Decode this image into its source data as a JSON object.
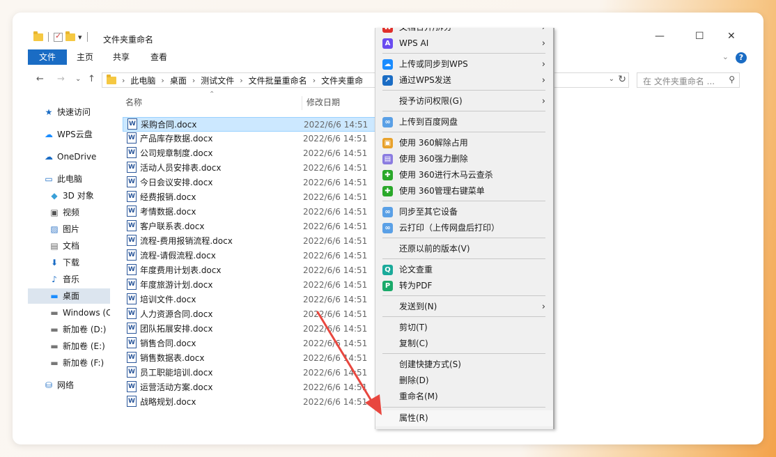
{
  "window": {
    "title": "文件夹重命名",
    "qat_dropdown": "▾",
    "min_glyph": "—",
    "max_glyph": "☐",
    "close_glyph": "✕"
  },
  "ribbon": {
    "tabs": [
      "文件",
      "主页",
      "共享",
      "查看"
    ],
    "help": "?"
  },
  "address": {
    "crumbs": [
      "此电脑",
      "桌面",
      "测试文件",
      "文件批量重命名",
      "文件夹重命"
    ],
    "search_placeholder": "在 文件夹重命名 ..."
  },
  "sidebar": {
    "items": [
      {
        "label": "快速访问",
        "icon": "star-icon"
      },
      {
        "label": "WPS云盘",
        "icon": "cloud-icon"
      },
      {
        "label": "OneDrive",
        "icon": "onedrive-icon"
      },
      {
        "label": "此电脑",
        "icon": "pc-icon"
      },
      {
        "label": "3D 对象",
        "icon": "cube-icon"
      },
      {
        "label": "视频",
        "icon": "video-icon"
      },
      {
        "label": "图片",
        "icon": "picture-icon"
      },
      {
        "label": "文档",
        "icon": "document-icon"
      },
      {
        "label": "下载",
        "icon": "download-icon"
      },
      {
        "label": "音乐",
        "icon": "music-icon"
      },
      {
        "label": "桌面",
        "icon": "desktop-icon"
      },
      {
        "label": "Windows (C",
        "icon": "drive-icon"
      },
      {
        "label": "新加卷 (D:)",
        "icon": "drive-icon"
      },
      {
        "label": "新加卷 (E:)",
        "icon": "drive-icon"
      },
      {
        "label": "新加卷 (F:)",
        "icon": "drive-icon"
      },
      {
        "label": "网络",
        "icon": "network-icon"
      }
    ],
    "selected": "桌面"
  },
  "filelist": {
    "columns": {
      "name": "名称",
      "date": "修改日期"
    },
    "files": [
      {
        "name": "采购合同.docx",
        "date": "2022/6/6 14:51"
      },
      {
        "name": "产品库存数据.docx",
        "date": "2022/6/6 14:51"
      },
      {
        "name": "公司规章制度.docx",
        "date": "2022/6/6 14:51"
      },
      {
        "name": "活动人员安排表.docx",
        "date": "2022/6/6 14:51"
      },
      {
        "name": "今日会议安排.docx",
        "date": "2022/6/6 14:51"
      },
      {
        "name": "经费报销.docx",
        "date": "2022/6/6 14:51"
      },
      {
        "name": "考情数据.docx",
        "date": "2022/6/6 14:51"
      },
      {
        "name": "客户联系表.docx",
        "date": "2022/6/6 14:51"
      },
      {
        "name": "流程-费用报销流程.docx",
        "date": "2022/6/6 14:51"
      },
      {
        "name": "流程-请假流程.docx",
        "date": "2022/6/6 14:51"
      },
      {
        "name": "年度费用计划表.docx",
        "date": "2022/6/6 14:51"
      },
      {
        "name": "年度旅游计划.docx",
        "date": "2022/6/6 14:51"
      },
      {
        "name": "培训文件.docx",
        "date": "2022/6/6 14:51"
      },
      {
        "name": "人力资源合同.docx",
        "date": "2022/6/6 14:51"
      },
      {
        "name": "团队拓展安排.docx",
        "date": "2022/6/6 14:51"
      },
      {
        "name": "销售合同.docx",
        "date": "2022/6/6 14:51"
      },
      {
        "name": "销售数据表.docx",
        "date": "2022/6/6 14:51"
      },
      {
        "name": "员工职能培训.docx",
        "date": "2022/6/6 14:51"
      },
      {
        "name": "运营活动方案.docx",
        "date": "2022/6/6 14:51"
      },
      {
        "name": "战略规划.docx",
        "date": "2022/6/6 14:51"
      }
    ]
  },
  "context_menu": {
    "items": [
      {
        "label": "文档合并/拆分",
        "icon": "wps-icon",
        "color": "#e0302b",
        "glyph": "W",
        "submenu": true
      },
      {
        "label": "WPS AI",
        "icon": "wps-ai-icon",
        "color": "#6a4cf0",
        "glyph": "A",
        "submenu": true
      },
      {
        "label": "上传或同步到WPS",
        "icon": "wps-cloud-icon",
        "color": "#1a8cff",
        "glyph": "☁",
        "submenu": true
      },
      {
        "label": "通过WPS发送",
        "icon": "share-icon",
        "color": "#1a6cc4",
        "glyph": "↗",
        "submenu": true
      },
      {
        "label": "授予访问权限(G)",
        "icon": "",
        "color": "",
        "glyph": "",
        "submenu": true
      },
      {
        "label": "上传到百度网盘",
        "icon": "baidu-icon",
        "color": "#5aa0e6",
        "glyph": "∞",
        "submenu": false
      },
      {
        "label": "使用 360解除占用",
        "icon": "360-unlock-icon",
        "color": "#e8a12a",
        "glyph": "▣",
        "submenu": false
      },
      {
        "label": "使用 360强力删除",
        "icon": "360-delete-icon",
        "color": "#8a7be0",
        "glyph": "▤",
        "submenu": false
      },
      {
        "label": "使用 360进行木马云查杀",
        "icon": "360-scan-icon",
        "color": "#2aa82a",
        "glyph": "✚",
        "submenu": false
      },
      {
        "label": "使用 360管理右键菜单",
        "icon": "360-menu-icon",
        "color": "#2aa82a",
        "glyph": "✚",
        "submenu": false
      },
      {
        "label": "同步至其它设备",
        "icon": "baidu-sync-icon",
        "color": "#5aa0e6",
        "glyph": "∞",
        "submenu": false
      },
      {
        "label": "云打印（上传网盘后打印）",
        "icon": "baidu-print-icon",
        "color": "#5aa0e6",
        "glyph": "∞",
        "submenu": false
      },
      {
        "label": "还原以前的版本(V)",
        "icon": "",
        "color": "",
        "glyph": "",
        "submenu": false
      },
      {
        "label": "论文查重",
        "icon": "paper-check-icon",
        "color": "#1aaa9a",
        "glyph": "Q",
        "submenu": false
      },
      {
        "label": "转为PDF",
        "icon": "pdf-icon",
        "color": "#1aaa6a",
        "glyph": "P",
        "submenu": false
      },
      {
        "label": "发送到(N)",
        "icon": "",
        "color": "",
        "glyph": "",
        "submenu": true
      },
      {
        "label": "剪切(T)",
        "icon": "",
        "color": "",
        "glyph": "",
        "submenu": false
      },
      {
        "label": "复制(C)",
        "icon": "",
        "color": "",
        "glyph": "",
        "submenu": false
      },
      {
        "label": "创建快捷方式(S)",
        "icon": "",
        "color": "",
        "glyph": "",
        "submenu": false
      },
      {
        "label": "删除(D)",
        "icon": "",
        "color": "",
        "glyph": "",
        "submenu": false
      },
      {
        "label": "重命名(M)",
        "icon": "",
        "color": "",
        "glyph": "",
        "submenu": false
      },
      {
        "label": "属性(R)",
        "icon": "",
        "color": "",
        "glyph": "",
        "submenu": false
      }
    ],
    "highlighted": "属性(R)"
  },
  "colors": {
    "accent": "#1a6cc4",
    "selection": "#cce8ff",
    "arrow": "#e8473f"
  }
}
